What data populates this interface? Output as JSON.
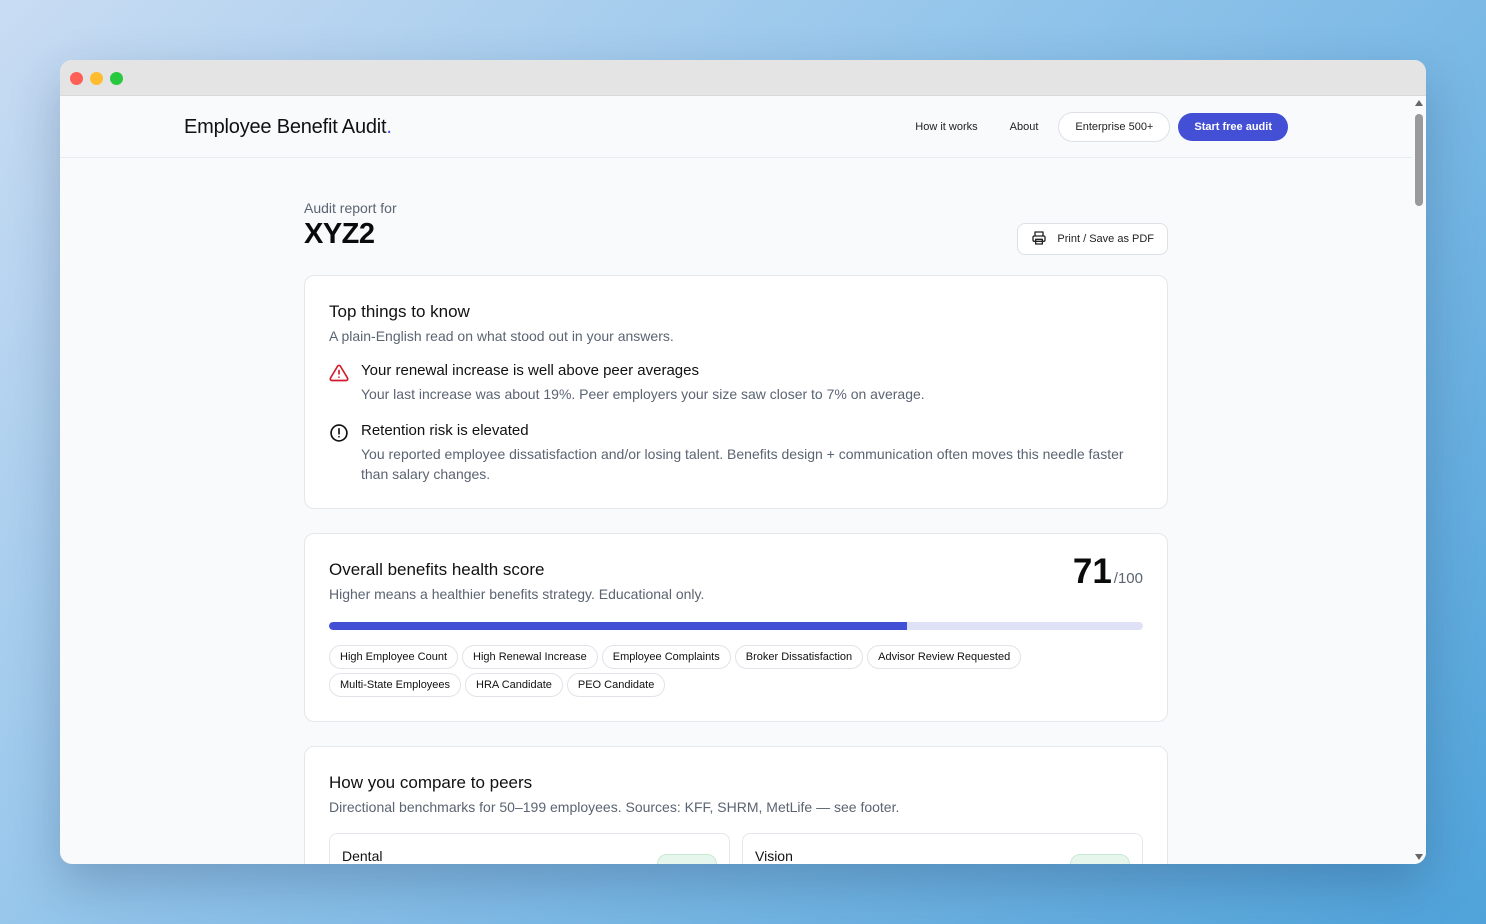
{
  "nav": {
    "brand": "Employee Benefit Audit",
    "brand_suffix": ".",
    "links": [
      "How it works",
      "About"
    ],
    "enterprise_label": "Enterprise 500+",
    "cta_label": "Start free audit"
  },
  "report": {
    "label": "Audit report for",
    "company": "XYZ2",
    "print_label": "Print / Save as PDF"
  },
  "top_things": {
    "title": "Top things to know",
    "description": "A plain-English read on what stood out in your answers.",
    "items": [
      {
        "icon": "warning-triangle-icon",
        "title": "Your renewal increase is well above peer averages",
        "body": "Your last increase was about 19%. Peer employers your size saw closer to 7% on average."
      },
      {
        "icon": "info-circle-icon",
        "title": "Retention risk is elevated",
        "body": "You reported employee dissatisfaction and/or losing talent. Benefits design + communication often moves this needle faster than salary changes."
      }
    ]
  },
  "health": {
    "title": "Overall benefits health score",
    "description": "Higher means a healthier benefits strategy. Educational only.",
    "score": "71",
    "score_max": "/100",
    "score_fraction": 0.71,
    "tags": [
      "High Employee Count",
      "High Renewal Increase",
      "Employee Complaints",
      "Broker Dissatisfaction",
      "Advisor Review Requested",
      "Multi-State Employees",
      "HRA Candidate",
      "PEO Candidate"
    ]
  },
  "peers": {
    "title": "How you compare to peers",
    "description": "Directional benchmarks for 50–199 employees. Sources: KFF, SHRM, MetLife — see footer.",
    "cards": [
      {
        "name": "Dental"
      },
      {
        "name": "Vision"
      }
    ]
  },
  "colors": {
    "primary": "#4350d6",
    "warning": "#d11a2a",
    "track": "#dfe1f7"
  }
}
